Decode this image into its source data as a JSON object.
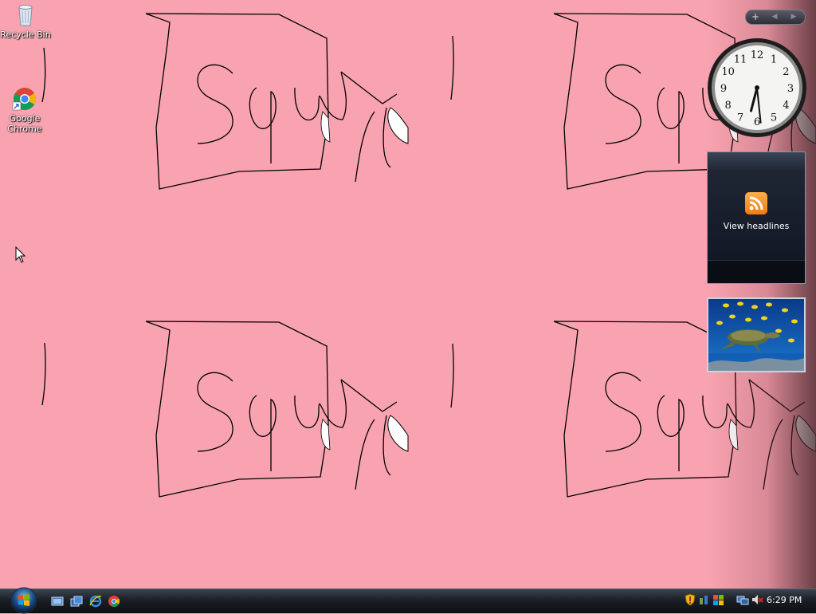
{
  "desktop": {
    "icons": [
      {
        "label": "Recycle Bin",
        "icon": "recycle-bin-icon"
      },
      {
        "label": "Google Chrome",
        "icon": "chrome-icon"
      }
    ]
  },
  "sidebar": {
    "controls": {
      "add": "+",
      "prev": "◀",
      "next": "▶"
    },
    "clock": {
      "hour": 6,
      "minute": 29,
      "numerals": [
        "12",
        "1",
        "2",
        "3",
        "4",
        "5",
        "6",
        "7",
        "8",
        "9",
        "10",
        "11"
      ]
    },
    "feed_gadget": {
      "label": "View headlines",
      "icon": "rss-icon"
    },
    "slideshow_gadget": {
      "icon": "sea-turtle-photo"
    }
  },
  "taskbar": {
    "start_icon": "windows-start-orb",
    "quick_launch": [
      "show-desktop-icon",
      "switch-windows-icon",
      "internet-explorer-icon",
      "chrome-icon"
    ],
    "tray_icons": [
      "security-shield-icon",
      "network-icon",
      "windows-update-icon",
      "network-connection-icon",
      "volume-muted-icon"
    ],
    "time": "6:29 PM"
  },
  "colors": {
    "wallpaper": "#f9a3b0",
    "taskbar": "#1b1f26",
    "accent": "#3a8de0"
  }
}
